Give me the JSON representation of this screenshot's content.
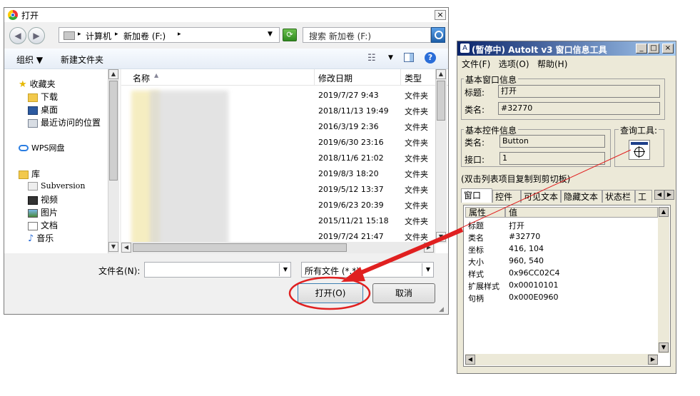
{
  "dialog": {
    "title": "打开",
    "close_glyph": "×",
    "address": {
      "sep1": "▸",
      "part1": "计算机",
      "sep2": "▸",
      "part2": "新加卷 (F:)",
      "sep3": "▸"
    },
    "search_placeholder": "搜索 新加卷 (F:)",
    "toolbar": {
      "organize": "组织 ▼",
      "new_folder": "新建文件夹"
    },
    "nav": {
      "favorites": "收藏夹",
      "items": [
        "下载",
        "桌面",
        "最近访问的位置"
      ],
      "wps": "WPS网盘",
      "library": "库",
      "lib_items": [
        "Subversion",
        "视频",
        "图片",
        "文档",
        "音乐"
      ]
    },
    "columns": {
      "name": "名称",
      "date": "修改日期",
      "type": "类型"
    },
    "rows": [
      {
        "date": "2019/7/27 9:43",
        "type": "文件夹"
      },
      {
        "date": "2018/11/13 19:49",
        "type": "文件夹"
      },
      {
        "date": "2016/3/19 2:36",
        "type": "文件夹"
      },
      {
        "date": "2019/6/30 23:16",
        "type": "文件夹"
      },
      {
        "date": "2018/11/6 21:02",
        "type": "文件夹"
      },
      {
        "date": "2019/8/3 18:20",
        "type": "文件夹"
      },
      {
        "date": "2019/5/12 13:37",
        "type": "文件夹"
      },
      {
        "date": "2019/6/23 20:39",
        "type": "文件夹"
      },
      {
        "date": "2015/11/21 15:18",
        "type": "文件夹"
      },
      {
        "date": "2019/7/24 21:47",
        "type": "文件夹"
      }
    ],
    "filename_label": "文件名(N):",
    "filename_value": "",
    "filter_value": "所有文件 (*.*)",
    "open_button": "打开(O)",
    "cancel_button": "取消"
  },
  "autoit": {
    "title": "(暂停中) AutoIt v3 窗口信息工具",
    "menu": [
      "文件(F)",
      "选项(O)",
      "帮助(H)"
    ],
    "window_group": "基本窗口信息",
    "title_label": "标题:",
    "title_value": "打开",
    "class_label": "类名:",
    "class_value": "#32770",
    "control_group": "基本控件信息",
    "ctl_class_label": "类名:",
    "ctl_class_value": "Button",
    "ctl_id_label": "接口:",
    "ctl_id_value": "1",
    "finder_label": "查询工具:",
    "hint": "(双击列表项目复制到剪切板)",
    "tabs": [
      "窗口",
      "控件",
      "可见文本",
      "隐藏文本",
      "状态栏",
      "工"
    ],
    "list_header": {
      "key": "属性",
      "value": "值"
    },
    "props": [
      {
        "k": "标题",
        "v": "打开"
      },
      {
        "k": "类名",
        "v": "#32770"
      },
      {
        "k": "坐标",
        "v": "416, 104"
      },
      {
        "k": "大小",
        "v": "960, 540"
      },
      {
        "k": "样式",
        "v": "0x96CC02C4"
      },
      {
        "k": "扩展样式",
        "v": "0x00010101"
      },
      {
        "k": "句柄",
        "v": "0x000E0960"
      }
    ]
  },
  "colors": {
    "annotation": "#e02020",
    "titlebar": "#0a246a",
    "link_blue": "#1e5fa8"
  }
}
